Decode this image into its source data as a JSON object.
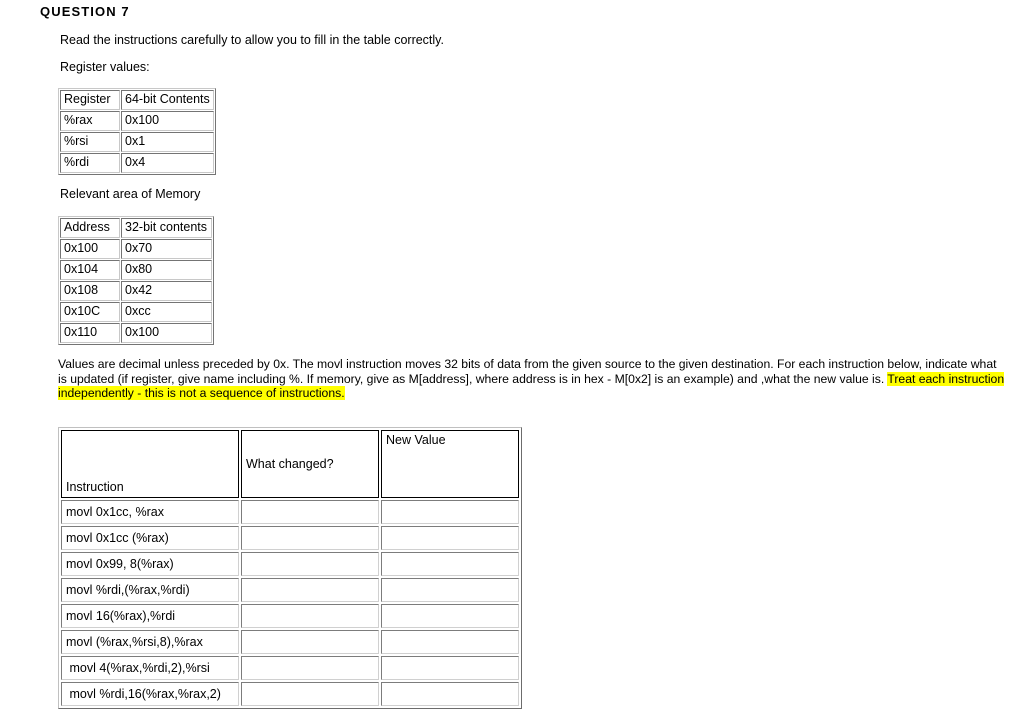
{
  "question": {
    "title": "QUESTION 7",
    "intro_line_1": "Read the instructions carefully to allow you to fill in the table correctly.",
    "intro_line_2": "Register values:"
  },
  "register_table": {
    "headers": [
      "Register",
      "64-bit Contents"
    ],
    "rows": [
      [
        "%rax",
        "0x100"
      ],
      [
        "%rsi",
        "0x1"
      ],
      [
        "%rdi",
        "0x4"
      ]
    ]
  },
  "memory_section": {
    "label": "Relevant area of Memory"
  },
  "memory_table": {
    "headers": [
      "Address",
      "32-bit contents"
    ],
    "rows": [
      [
        "0x100",
        "0x70"
      ],
      [
        "0x104",
        "0x80"
      ],
      [
        "0x108",
        "0x42"
      ],
      [
        "0x10C",
        "0xcc"
      ],
      [
        "0x110",
        "0x100"
      ]
    ]
  },
  "paragraph": {
    "part_1": "Values are decimal unless preceded by 0x. The movl instruction moves 32 bits of data from the given source to the given destination.  For each instruction below, indicate what is updated (if register, give name including %.   If memory, give as M[address], where address is in hex - M[0x2] is an example) and ,what the new value is.  ",
    "highlighted": "Treat each instruction independently - this is not a sequence of instructions.",
    "highlight_color": "#ffff00"
  },
  "answer_table": {
    "headers": [
      "Instruction",
      "What changed?",
      "New Value"
    ],
    "rows": [
      {
        "instruction": "movl 0x1cc, %rax",
        "what_changed": "",
        "new_value": ""
      },
      {
        "instruction": "movl 0x1cc (%rax)",
        "what_changed": "",
        "new_value": ""
      },
      {
        "instruction": "movl 0x99, 8(%rax)",
        "what_changed": "",
        "new_value": ""
      },
      {
        "instruction": "movl %rdi,(%rax,%rdi)",
        "what_changed": "",
        "new_value": ""
      },
      {
        "instruction": "movl 16(%rax),%rdi",
        "what_changed": "",
        "new_value": ""
      },
      {
        "instruction": "movl (%rax,%rsi,8),%rax",
        "what_changed": "",
        "new_value": ""
      },
      {
        "instruction": " movl 4(%rax,%rdi,2),%rsi",
        "what_changed": "",
        "new_value": ""
      },
      {
        "instruction": " movl %rdi,16(%rax,%rax,2)",
        "what_changed": "",
        "new_value": ""
      }
    ]
  }
}
